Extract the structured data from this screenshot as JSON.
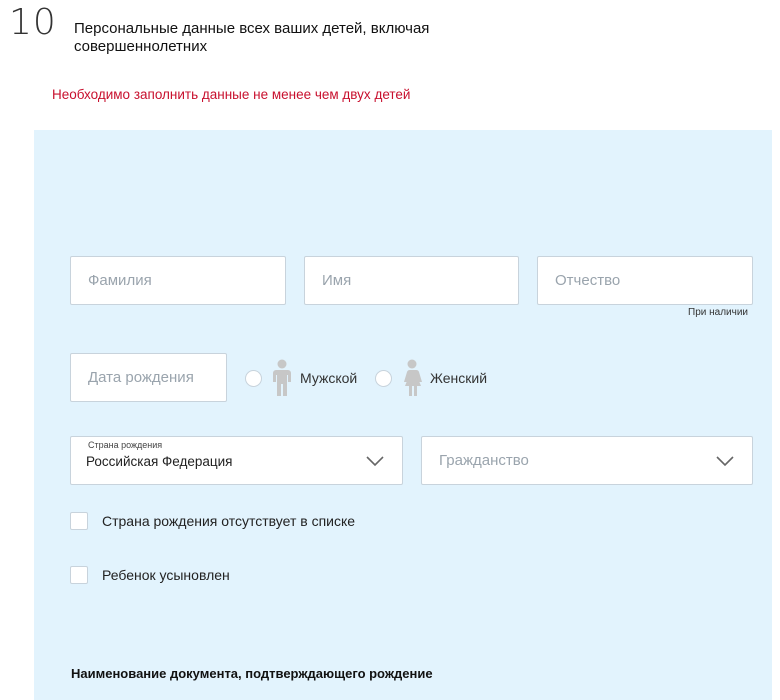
{
  "step": {
    "number": "10",
    "title": "Персональные данные всех ваших детей, включая совершеннолетних"
  },
  "error": "Необходимо заполнить данные не менее чем двух детей",
  "form": {
    "last_name_placeholder": "Фамилия",
    "first_name_placeholder": "Имя",
    "patronymic_placeholder": "Отчество",
    "patronymic_hint": "При наличии",
    "birth_date_placeholder": "Дата рождения",
    "gender_male": "Мужской",
    "gender_female": "Женский",
    "birth_country_label": "Страна рождения",
    "birth_country_value": "Российская Федерация",
    "citizenship_placeholder": "Гражданство",
    "checkbox_country_missing": "Страна рождения отсутствует в списке",
    "checkbox_adopted": "Ребенок усыновлен",
    "birth_doc_heading": "Наименование документа, подтверждающего рождение"
  },
  "colors": {
    "panel_bg": "#e2f3fd",
    "error": "#c8102e",
    "icon_gray": "#c7c7c7"
  }
}
